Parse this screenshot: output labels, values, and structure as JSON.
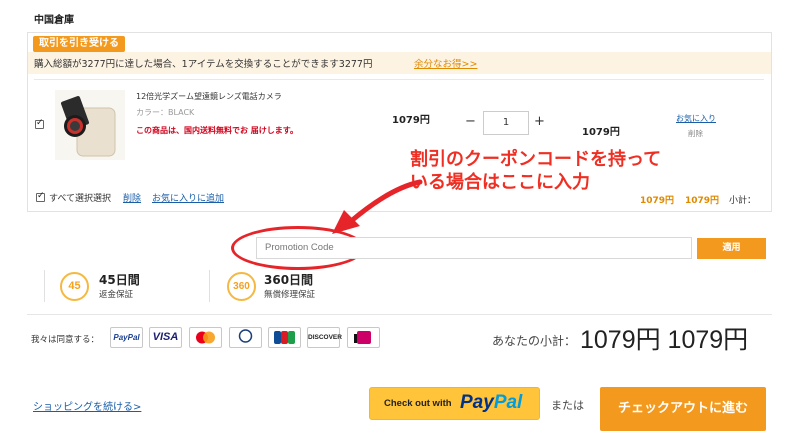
{
  "warehouse": {
    "title": "中国倉庫"
  },
  "promo": {
    "tag": "取引を引き受ける",
    "text": "購入総額が3277円に達した場合、1アイテムを交換することができます3277円",
    "link": "余分なお得>>"
  },
  "item": {
    "name": "12倍光学ズーム望遠鏡レンズ電話カメラ",
    "color": "カラー：BLACK",
    "note": "この商品は、国内送料無料でお 届けします。",
    "price": "1079円",
    "quantity": "1",
    "subtotal": "1079円",
    "fav_label": "お気に入り",
    "delete_label": "削除"
  },
  "cart_footer": {
    "select_all": "すべて選択選択",
    "delete": "削除",
    "add_favorites": "お気に入りに追加",
    "price_1": "1079円",
    "price_2": "1079円",
    "subtotal_label": "小計："
  },
  "annotation": {
    "line1": "割引のクーポンコードを持って",
    "line2": "いる場合はここに入力"
  },
  "coupon": {
    "placeholder": "Promotion Code",
    "apply": "適用"
  },
  "guarantees": [
    {
      "icon": "45",
      "title": "45日間",
      "sub": "返金保証"
    },
    {
      "icon": "360",
      "title": "360日間",
      "sub": "無償修理保証"
    }
  ],
  "payment": {
    "agree_label": "我々は同意する：",
    "methods": [
      "PayPal",
      "VISA",
      "Mastercard",
      "Diners Club",
      "JCB",
      "DISCOVER",
      "iDEAL"
    ]
  },
  "totals": {
    "label": "あなたの小計：",
    "value": "1079円 1079円"
  },
  "actions": {
    "continue": "ショッピングを続ける>",
    "paypal_prefix": "Check out with",
    "paypal_logo_1": "Pay",
    "paypal_logo_2": "Pal",
    "or": "または",
    "checkout": "チェックアウトに進む"
  },
  "colors": {
    "accent": "#f39a1e",
    "link": "#1a5ea8",
    "annotation": "#ef2f23",
    "paypal": "#ffc439"
  }
}
